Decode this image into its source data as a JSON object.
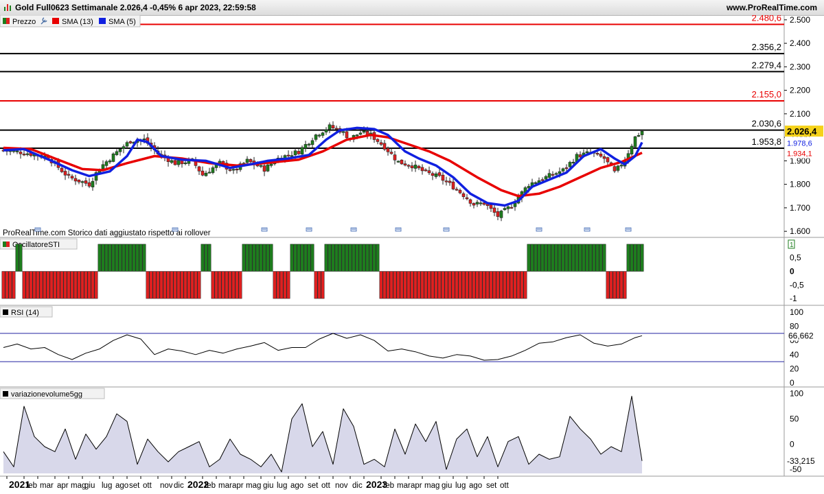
{
  "header": {
    "title": "Gold Full0623 Settimanale 2.026,4 -0,45% 6 apr 2023, 22:59:58",
    "site": "www.ProRealTime.com"
  },
  "legend": {
    "price": "Prezzo",
    "sma13": "SMA (13)",
    "sma5": "SMA (5)"
  },
  "notice": "ProRealTime.com  Storico dati aggiustato rispetto ai rollover",
  "panels": {
    "osc_title": "OscillatoreSTI",
    "osc_badge": "1",
    "rsi_title": "RSI (14)",
    "rsi_value": "66,662",
    "vol_title": "variazionevolume5gg",
    "vol_value": "-33,215"
  },
  "colors": {
    "up": "#1e7e1e",
    "down": "#e02020",
    "sma13": "#e80000",
    "sma5": "#1020e0",
    "red_level": "#e80000",
    "black_level": "#000000",
    "price_tag": "#f5d21a"
  },
  "chart_data": [
    {
      "type": "candlestick",
      "panel": "price",
      "ylim": [
        1580,
        2520
      ],
      "y_ticks": [
        "2.500",
        "2.400",
        "2.300",
        "2.200",
        "2.100",
        "2.000",
        "1.900",
        "1.800",
        "1.700",
        "1.600"
      ],
      "levels": [
        {
          "value": 2480.6,
          "label": "2.480,6",
          "color": "red"
        },
        {
          "value": 2356.2,
          "label": "2.356,2",
          "color": "black"
        },
        {
          "value": 2279.4,
          "label": "2.279,4",
          "color": "black"
        },
        {
          "value": 2155.0,
          "label": "2.155,0",
          "color": "red"
        },
        {
          "value": 2030.6,
          "label": "2.030,6",
          "color": "black"
        },
        {
          "value": 1953.8,
          "label": "1.953,8",
          "color": "black"
        }
      ],
      "last_price": {
        "value": 2026.4,
        "label": "2.026,4"
      },
      "sma5_last": {
        "value": 1978.6,
        "label": "1.978,6"
      },
      "sma13_last": {
        "value": 1934.1,
        "label": "1.934,1"
      },
      "close_points": [
        [
          0,
          1945
        ],
        [
          6,
          1935
        ],
        [
          13,
          1915
        ],
        [
          19,
          1830
        ],
        [
          25,
          1800
        ],
        [
          28,
          1870
        ],
        [
          34,
          1950
        ],
        [
          37,
          1985
        ],
        [
          41,
          1990
        ],
        [
          45,
          1930
        ],
        [
          50,
          1890
        ],
        [
          55,
          1900
        ],
        [
          58,
          1840
        ],
        [
          63,
          1890
        ],
        [
          67,
          1855
        ],
        [
          71,
          1900
        ],
        [
          76,
          1865
        ],
        [
          80,
          1910
        ],
        [
          86,
          1940
        ],
        [
          91,
          2010
        ],
        [
          95,
          2045
        ],
        [
          98,
          2030
        ],
        [
          101,
          1995
        ],
        [
          104,
          2020
        ],
        [
          107,
          2010
        ],
        [
          111,
          1960
        ],
        [
          115,
          1895
        ],
        [
          119,
          1880
        ],
        [
          123,
          1850
        ],
        [
          127,
          1830
        ],
        [
          131,
          1790
        ],
        [
          134,
          1755
        ],
        [
          137,
          1715
        ],
        [
          140,
          1720
        ],
        [
          144,
          1665
        ],
        [
          148,
          1710
        ],
        [
          153,
          1800
        ],
        [
          158,
          1830
        ],
        [
          163,
          1860
        ],
        [
          167,
          1920
        ],
        [
          171,
          1935
        ],
        [
          175,
          1910
        ],
        [
          178,
          1850
        ],
        [
          181,
          1905
        ],
        [
          184,
          2000
        ],
        [
          186,
          2026.4
        ]
      ],
      "sma13_points": [
        [
          0,
          1955
        ],
        [
          8,
          1950
        ],
        [
          15,
          1910
        ],
        [
          23,
          1865
        ],
        [
          29,
          1860
        ],
        [
          36,
          1890
        ],
        [
          44,
          1920
        ],
        [
          52,
          1910
        ],
        [
          60,
          1890
        ],
        [
          68,
          1880
        ],
        [
          76,
          1890
        ],
        [
          86,
          1905
        ],
        [
          93,
          1940
        ],
        [
          100,
          1990
        ],
        [
          107,
          2010
        ],
        [
          112,
          2000
        ],
        [
          118,
          1970
        ],
        [
          124,
          1940
        ],
        [
          130,
          1900
        ],
        [
          138,
          1830
        ],
        [
          145,
          1775
        ],
        [
          150,
          1750
        ],
        [
          156,
          1760
        ],
        [
          162,
          1790
        ],
        [
          168,
          1830
        ],
        [
          174,
          1870
        ],
        [
          180,
          1895
        ],
        [
          186,
          1934.1
        ]
      ],
      "sma5_points": [
        [
          0,
          1945
        ],
        [
          6,
          1950
        ],
        [
          14,
          1900
        ],
        [
          20,
          1860
        ],
        [
          25,
          1835
        ],
        [
          31,
          1855
        ],
        [
          36,
          1920
        ],
        [
          39,
          1990
        ],
        [
          42,
          1980
        ],
        [
          46,
          1920
        ],
        [
          52,
          1905
        ],
        [
          59,
          1900
        ],
        [
          66,
          1870
        ],
        [
          72,
          1885
        ],
        [
          77,
          1900
        ],
        [
          83,
          1910
        ],
        [
          89,
          1925
        ],
        [
          94,
          1990
        ],
        [
          98,
          2030
        ],
        [
          103,
          2040
        ],
        [
          108,
          2035
        ],
        [
          112,
          2010
        ],
        [
          117,
          1940
        ],
        [
          121,
          1910
        ],
        [
          126,
          1880
        ],
        [
          131,
          1830
        ],
        [
          136,
          1760
        ],
        [
          141,
          1720
        ],
        [
          146,
          1710
        ],
        [
          150,
          1730
        ],
        [
          154,
          1790
        ],
        [
          159,
          1820
        ],
        [
          164,
          1850
        ],
        [
          169,
          1920
        ],
        [
          174,
          1950
        ],
        [
          178,
          1910
        ],
        [
          181,
          1885
        ],
        [
          184,
          1920
        ],
        [
          186,
          1978.6
        ]
      ]
    },
    {
      "type": "bar",
      "panel": "oscillator",
      "ylim": [
        -1.2,
        1.2
      ],
      "y_ticks": [
        "1",
        "0,5",
        "0",
        "-0,5",
        "-1"
      ],
      "runs": [
        {
          "from": 0,
          "to": 3,
          "value": -1
        },
        {
          "from": 4,
          "to": 5,
          "value": 1
        },
        {
          "from": 6,
          "to": 27,
          "value": -1
        },
        {
          "from": 28,
          "to": 41,
          "value": 1
        },
        {
          "from": 42,
          "to": 57,
          "value": -1
        },
        {
          "from": 58,
          "to": 60,
          "value": 1
        },
        {
          "from": 61,
          "to": 69,
          "value": -1
        },
        {
          "from": 70,
          "to": 78,
          "value": 1
        },
        {
          "from": 79,
          "to": 83,
          "value": -1
        },
        {
          "from": 84,
          "to": 90,
          "value": 1
        },
        {
          "from": 91,
          "to": 93,
          "value": -1
        },
        {
          "from": 94,
          "to": 109,
          "value": 1
        },
        {
          "from": 110,
          "to": 152,
          "value": -1
        },
        {
          "from": 153,
          "to": 175,
          "value": 1
        },
        {
          "from": 176,
          "to": 181,
          "value": -1
        },
        {
          "from": 182,
          "to": 186,
          "value": 1
        }
      ]
    },
    {
      "type": "line",
      "panel": "rsi",
      "ylim": [
        0,
        100
      ],
      "y_ticks": [
        "100",
        "80",
        "60",
        "40",
        "20",
        "0"
      ],
      "upper_level": 70,
      "lower_level": 30,
      "last": 66.662,
      "points": [
        [
          0,
          50
        ],
        [
          4,
          55
        ],
        [
          8,
          48
        ],
        [
          12,
          50
        ],
        [
          16,
          40
        ],
        [
          20,
          33
        ],
        [
          24,
          42
        ],
        [
          28,
          48
        ],
        [
          32,
          60
        ],
        [
          36,
          68
        ],
        [
          40,
          62
        ],
        [
          44,
          40
        ],
        [
          48,
          48
        ],
        [
          52,
          45
        ],
        [
          56,
          40
        ],
        [
          60,
          46
        ],
        [
          64,
          42
        ],
        [
          68,
          48
        ],
        [
          72,
          52
        ],
        [
          76,
          57
        ],
        [
          80,
          46
        ],
        [
          84,
          50
        ],
        [
          88,
          50
        ],
        [
          92,
          62
        ],
        [
          96,
          70
        ],
        [
          100,
          63
        ],
        [
          104,
          68
        ],
        [
          108,
          60
        ],
        [
          112,
          45
        ],
        [
          116,
          48
        ],
        [
          120,
          44
        ],
        [
          124,
          38
        ],
        [
          128,
          35
        ],
        [
          132,
          40
        ],
        [
          136,
          38
        ],
        [
          140,
          32
        ],
        [
          144,
          33
        ],
        [
          148,
          38
        ],
        [
          152,
          46
        ],
        [
          156,
          56
        ],
        [
          160,
          58
        ],
        [
          164,
          64
        ],
        [
          168,
          68
        ],
        [
          172,
          56
        ],
        [
          176,
          52
        ],
        [
          180,
          55
        ],
        [
          184,
          64
        ],
        [
          186,
          66.662
        ]
      ]
    },
    {
      "type": "area",
      "panel": "volume",
      "ylim": [
        -58,
        105
      ],
      "y_ticks": [
        "100",
        "50",
        "0",
        "-50"
      ],
      "last": -33.215,
      "points": [
        [
          0,
          -15
        ],
        [
          3,
          -45
        ],
        [
          6,
          75
        ],
        [
          9,
          15
        ],
        [
          12,
          -5
        ],
        [
          15,
          -15
        ],
        [
          18,
          30
        ],
        [
          21,
          -30
        ],
        [
          24,
          20
        ],
        [
          27,
          -10
        ],
        [
          30,
          15
        ],
        [
          33,
          60
        ],
        [
          36,
          45
        ],
        [
          39,
          -40
        ],
        [
          42,
          10
        ],
        [
          45,
          -15
        ],
        [
          48,
          -35
        ],
        [
          51,
          -15
        ],
        [
          54,
          -5
        ],
        [
          57,
          5
        ],
        [
          60,
          -45
        ],
        [
          63,
          -30
        ],
        [
          66,
          10
        ],
        [
          69,
          -20
        ],
        [
          72,
          -30
        ],
        [
          75,
          -45
        ],
        [
          78,
          -20
        ],
        [
          81,
          -55
        ],
        [
          84,
          50
        ],
        [
          87,
          80
        ],
        [
          90,
          -5
        ],
        [
          93,
          25
        ],
        [
          96,
          -40
        ],
        [
          99,
          70
        ],
        [
          102,
          35
        ],
        [
          105,
          -40
        ],
        [
          108,
          -30
        ],
        [
          111,
          -45
        ],
        [
          114,
          30
        ],
        [
          117,
          -20
        ],
        [
          120,
          40
        ],
        [
          123,
          5
        ],
        [
          126,
          45
        ],
        [
          129,
          -50
        ],
        [
          132,
          10
        ],
        [
          135,
          30
        ],
        [
          138,
          -25
        ],
        [
          141,
          15
        ],
        [
          144,
          -45
        ],
        [
          147,
          5
        ],
        [
          150,
          15
        ],
        [
          153,
          -40
        ],
        [
          156,
          -20
        ],
        [
          159,
          -30
        ],
        [
          162,
          -25
        ],
        [
          165,
          55
        ],
        [
          168,
          30
        ],
        [
          171,
          10
        ],
        [
          174,
          -20
        ],
        [
          177,
          -5
        ],
        [
          180,
          -15
        ],
        [
          183,
          95
        ],
        [
          186,
          -33.215
        ]
      ]
    }
  ],
  "x_axis": {
    "labels": [
      {
        "text": "2021",
        "bold": true,
        "week": 1
      },
      {
        "text": "feb",
        "week": 6
      },
      {
        "text": "mar",
        "week": 10
      },
      {
        "text": "apr",
        "week": 15
      },
      {
        "text": "mag",
        "week": 19
      },
      {
        "text": "giu",
        "week": 23
      },
      {
        "text": "lug",
        "week": 28
      },
      {
        "text": "ago",
        "week": 32
      },
      {
        "text": "set",
        "week": 36
      },
      {
        "text": "ott",
        "week": 40
      },
      {
        "text": "nov",
        "week": 45
      },
      {
        "text": "dic",
        "week": 49
      },
      {
        "text": "2022",
        "bold": true,
        "week": 53
      },
      {
        "text": "feb",
        "week": 58
      },
      {
        "text": "mar",
        "week": 62
      },
      {
        "text": "apr",
        "week": 66
      },
      {
        "text": "mag",
        "week": 70
      },
      {
        "text": "giu",
        "week": 75
      },
      {
        "text": "lug",
        "week": 79
      },
      {
        "text": "ago",
        "week": 83
      },
      {
        "text": "set",
        "week": 88
      },
      {
        "text": "ott",
        "week": 92
      },
      {
        "text": "nov",
        "week": 96
      },
      {
        "text": "dic",
        "week": 101
      },
      {
        "text": "2023",
        "bold": true,
        "week": 105
      },
      {
        "text": "feb",
        "week": 110
      },
      {
        "text": "mar",
        "week": 114
      },
      {
        "text": "apr",
        "week": 118
      },
      {
        "text": "mag",
        "week": 122
      },
      {
        "text": "giu",
        "week": 127
      },
      {
        "text": "lug",
        "week": 131
      },
      {
        "text": "ago",
        "week": 135
      },
      {
        "text": "set",
        "week": 140
      },
      {
        "text": "ott",
        "week": 144
      }
    ]
  }
}
